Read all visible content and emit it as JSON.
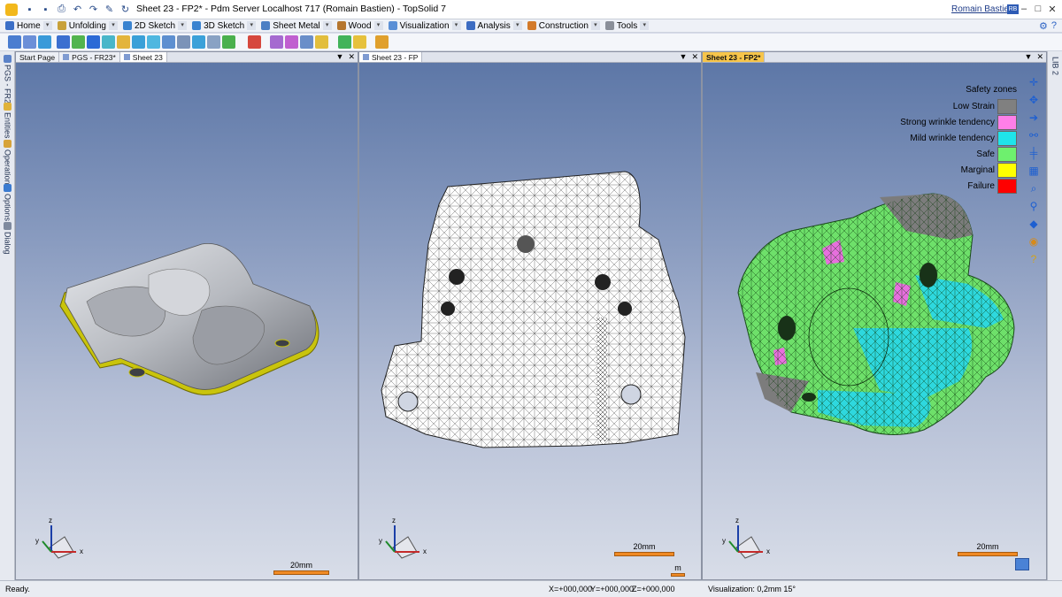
{
  "window": {
    "title": "Sheet 23 - FP2* - Pdm Server Localhost 717 (Romain Bastien) - TopSolid 7",
    "user": "Romain Bastien",
    "user_badge": "RB"
  },
  "quick_access": [
    "save-icon",
    "save-all-icon",
    "print-icon",
    "undo-icon",
    "redo-icon",
    "pen-icon",
    "refresh-icon"
  ],
  "menu": [
    {
      "label": "Home",
      "color": "#3b6fc7"
    },
    {
      "label": "Unfolding",
      "color": "#c8a13a"
    },
    {
      "label": "2D Sketch",
      "color": "#3a83d0"
    },
    {
      "label": "3D Sketch",
      "color": "#3a83d0"
    },
    {
      "label": "Sheet Metal",
      "color": "#4b7fc4"
    },
    {
      "label": "Wood",
      "color": "#b5762f"
    },
    {
      "label": "Visualization",
      "color": "#5a8fd6"
    },
    {
      "label": "Analysis",
      "color": "#3c6cc2"
    },
    {
      "label": "Construction",
      "color": "#d37a2a"
    },
    {
      "label": "Tools",
      "color": "#8a8f99"
    }
  ],
  "left_tabs": [
    "PGS - FR29",
    "Entities",
    "Operations",
    "Options",
    "Dialog"
  ],
  "right_tabs": [
    "LIB 2"
  ],
  "panes": [
    {
      "tabs": [
        "Start Page",
        "PGS - FR23*",
        "Sheet 23"
      ],
      "scale_label": "20mm"
    },
    {
      "tabs": [
        "Sheet 23 - FP"
      ],
      "scale_label": "20mm",
      "scale_label_2": "m"
    },
    {
      "tabs": [
        "Sheet 23 - FP2*"
      ],
      "scale_label": "20mm"
    }
  ],
  "legend": {
    "title": "Safety zones",
    "items": [
      {
        "label": "Low Strain",
        "color": "#808080"
      },
      {
        "label": "Strong wrinkle tendency",
        "color": "#ff7fe8"
      },
      {
        "label": "Mild wrinkle tendency",
        "color": "#1fe4ea"
      },
      {
        "label": "Safe",
        "color": "#6ef06e"
      },
      {
        "label": "Marginal",
        "color": "#ffff00"
      },
      {
        "label": "Failure",
        "color": "#ff0000"
      }
    ]
  },
  "axes": {
    "x": "x",
    "y": "y",
    "z": "z"
  },
  "status": {
    "ready": "Ready.",
    "x": "X=+000,000",
    "y": "Y=+000,000",
    "z": "Z=+000,000",
    "visualization": "Visualization: 0,2mm 15°"
  }
}
